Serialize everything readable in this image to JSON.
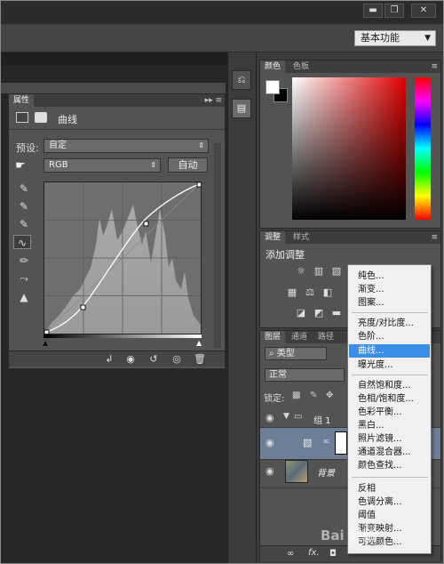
{
  "window": {
    "minimize_label": "▬",
    "restore_label": "❐",
    "close_label": "✕"
  },
  "workspace": {
    "selected": "基本功能"
  },
  "properties": {
    "tab_label": "属性",
    "type_label": "曲线",
    "preset_label": "预设:",
    "preset_value": "自定",
    "channel_value": "RGB",
    "auto_button": "自动"
  },
  "color_panel": {
    "tabs": [
      "颜色",
      "色板"
    ],
    "foreground": "#ffffff",
    "background": "#000000"
  },
  "adjustments_panel": {
    "tabs": [
      "调整",
      "样式"
    ],
    "heading": "添加调整"
  },
  "layers_panel": {
    "tabs": [
      "图层",
      "通道",
      "路径"
    ],
    "filter_label": "类型",
    "blend_mode": "正常",
    "lock_label": "锁定:",
    "layers": [
      {
        "name": "组 1"
      },
      {
        "name": ""
      },
      {
        "name": "背景"
      }
    ]
  },
  "context_menu": {
    "group1": [
      "纯色...",
      "渐变...",
      "图案..."
    ],
    "group2": [
      "亮度/对比度...",
      "色阶...",
      "曲线...",
      "曝光度..."
    ],
    "group3": [
      "自然饱和度...",
      "色相/饱和度...",
      "色彩平衡...",
      "黑白...",
      "照片滤镜...",
      "通道混合器...",
      "颜色查找..."
    ],
    "group4": [
      "反相",
      "色调分离...",
      "阈值",
      "渐变映射...",
      "可选颜色..."
    ],
    "highlighted": "曲线..."
  },
  "watermark": {
    "text": "Bai 经验"
  },
  "colors": {
    "accent_highlight": "#3a8ee6",
    "panel_bg": "#535353",
    "dark_bg": "#262626"
  }
}
